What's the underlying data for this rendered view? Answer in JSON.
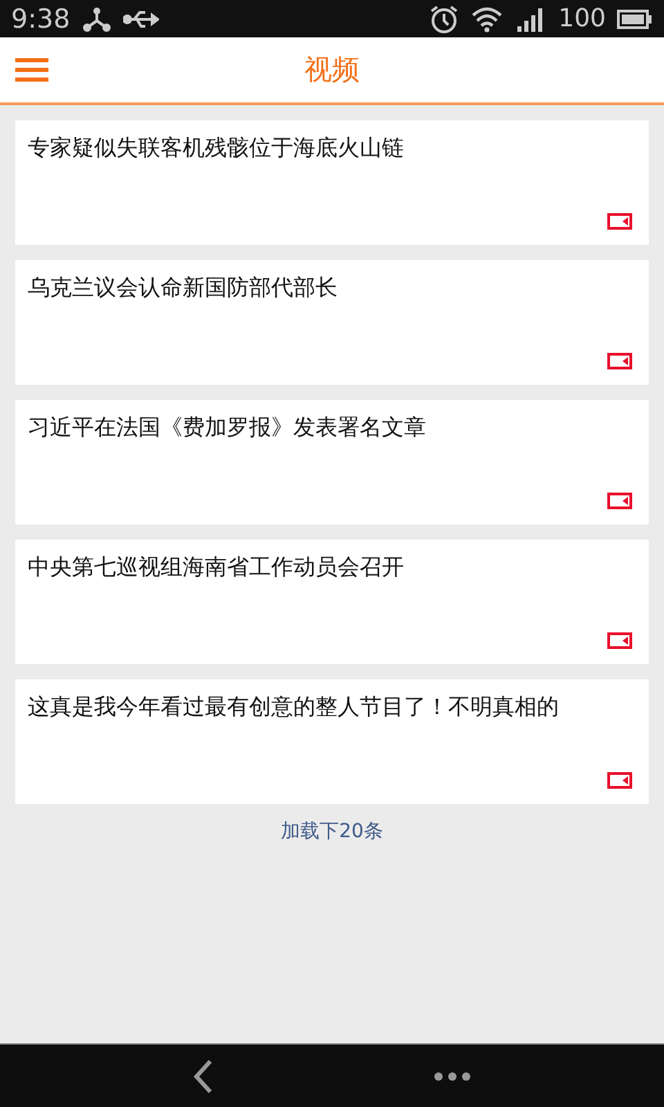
{
  "status_bar": {
    "time": "9:38",
    "battery": "100"
  },
  "header": {
    "title": "视频"
  },
  "articles": [
    {
      "title": "专家疑似失联客机残骸位于海底火山链",
      "kind": "video"
    },
    {
      "title": "乌克兰议会认命新国防部代部长",
      "kind": "video"
    },
    {
      "title": "习近平在法国《费加罗报》发表署名文章",
      "kind": "video"
    },
    {
      "title": "中央第七巡视组海南省工作动员会召开",
      "kind": "video"
    },
    {
      "title": "这真是我今年看过最有创意的整人节目了！不明真相的",
      "kind": "video"
    }
  ],
  "load_more": "加载下20条"
}
